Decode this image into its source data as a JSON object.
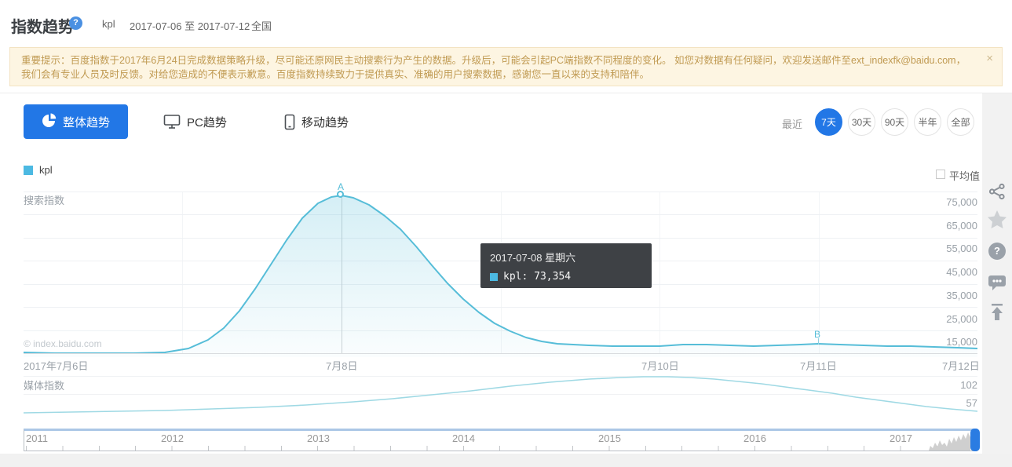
{
  "header": {
    "title": "指数趋势",
    "help_glyph": "?",
    "keyword": "kpl",
    "date_range": "2017-07-06 至 2017-07-12",
    "region": "全国"
  },
  "notice": {
    "text": "重要提示：百度指数于2017年6月24日完成数据策略升级，尽可能还原网民主动搜索行为产生的数据。升级后，可能会引起PC端指数不同程度的变化。 如您对数据有任何疑问，欢迎发送邮件至ext_indexfk@baidu.com，我们会有专业人员及时反馈。对给您造成的不便表示歉意。百度指数持续致力于提供真实、准确的用户搜索数据，感谢您一直以来的支持和陪伴。",
    "close_glyph": "×"
  },
  "tabs": [
    {
      "label": "整体趋势",
      "active": true
    },
    {
      "label": "PC趋势",
      "active": false
    },
    {
      "label": "移动趋势",
      "active": false
    }
  ],
  "range_selector": {
    "label": "最近",
    "options": [
      {
        "label": "7天",
        "active": true
      },
      {
        "label": "30天",
        "active": false
      },
      {
        "label": "90天",
        "active": false
      },
      {
        "label": "半年",
        "active": false
      },
      {
        "label": "全部",
        "active": false
      }
    ]
  },
  "legend": {
    "series": "kpl",
    "average_label": "平均值"
  },
  "search_chart": {
    "label": "搜索指数",
    "watermark": "© index.baidu.com",
    "y_ticks": [
      "75,000",
      "65,000",
      "55,000",
      "45,000",
      "35,000",
      "25,000",
      "15,000"
    ],
    "x_ticks": [
      "2017年7月6日",
      "7月8日",
      "7月10日",
      "7月11日",
      "7月12日"
    ],
    "marker_a": "A",
    "marker_b": "B"
  },
  "tooltip": {
    "date": "2017-07-08 星期六",
    "value_line": "kpl: 73,354"
  },
  "media_chart": {
    "label": "媒体指数",
    "y_ticks": [
      "102",
      "57"
    ]
  },
  "timeline": {
    "years": [
      "2011",
      "2012",
      "2013",
      "2014",
      "2015",
      "2016",
      "2017"
    ]
  },
  "side_toolbar": {
    "icons": [
      "share",
      "favorite",
      "help",
      "feedback",
      "back-to-top"
    ],
    "help_glyph": "?"
  },
  "colors": {
    "accent_blue": "#2277e6",
    "series_teal": "#56bdd8",
    "media_teal": "#9fd9e4",
    "notice_bg": "#fdf5e2",
    "notice_text": "#c09a52",
    "tooltip_bg": "#2f3337"
  },
  "chart_data": [
    {
      "type": "line",
      "title": "搜索指数 (kpl)",
      "x": [
        "2017-07-06",
        "2017-07-07",
        "2017-07-08",
        "2017-07-09",
        "2017-07-10",
        "2017-07-11",
        "2017-07-12"
      ],
      "series": [
        {
          "name": "kpl",
          "values": [
            5500,
            9000,
            73354,
            16000,
            8200,
            9200,
            7200
          ]
        }
      ],
      "y_ticks": [
        15000,
        25000,
        35000,
        45000,
        55000,
        65000,
        75000
      ],
      "ylim": [
        5000,
        85000
      ],
      "grid": true,
      "annotations": [
        {
          "label": "A",
          "x": "2017-07-08",
          "y": 73354
        },
        {
          "label": "B",
          "x": "2017-07-11",
          "y": 9200
        }
      ],
      "note": "values estimated from pixels except 73,354 shown in tooltip"
    },
    {
      "type": "line",
      "title": "媒体指数",
      "x": [
        "2017-07-06",
        "2017-07-07",
        "2017-07-08",
        "2017-07-09",
        "2017-07-10",
        "2017-07-11",
        "2017-07-12"
      ],
      "series": [
        {
          "name": "kpl",
          "values": [
            12,
            16,
            37,
            74,
            102,
            61,
            14
          ]
        }
      ],
      "y_ticks": [
        57,
        102
      ],
      "note": "values estimated from pixels"
    },
    {
      "type": "area",
      "title": "时间轴导航",
      "x": [
        "2011",
        "2012",
        "2013",
        "2014",
        "2015",
        "2016",
        "2017"
      ],
      "note": "navigator strip; activity spike near 2017 with blue drag handle at right"
    }
  ]
}
